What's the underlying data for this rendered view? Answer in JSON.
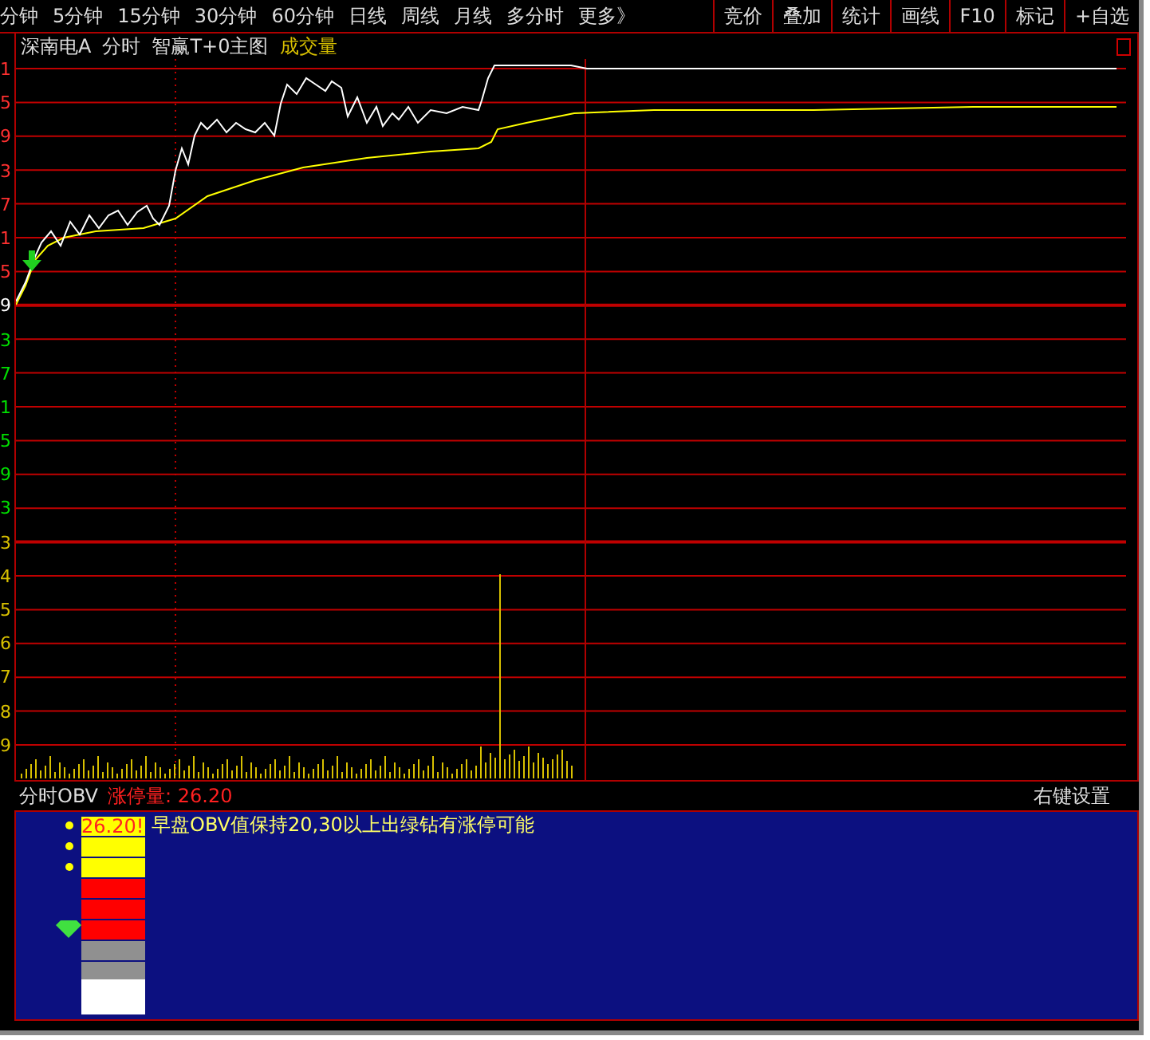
{
  "toolbar": {
    "periods": [
      {
        "label": "分钟",
        "selected": false
      },
      {
        "label": "5分钟",
        "selected": false
      },
      {
        "label": "15分钟",
        "selected": false
      },
      {
        "label": "30分钟",
        "selected": false
      },
      {
        "label": "60分钟",
        "selected": false
      },
      {
        "label": "日线",
        "selected": false
      },
      {
        "label": "周线",
        "selected": false
      },
      {
        "label": "月线",
        "selected": false
      },
      {
        "label": "多分时",
        "selected": false
      },
      {
        "label": "更多》",
        "selected": false
      }
    ],
    "buttons": [
      "竞价",
      "叠加",
      "统计",
      "画线",
      "F10",
      "标记",
      "+自选"
    ]
  },
  "chart": {
    "stock": "深南电A",
    "mode": "分时",
    "indicator": "智赢T+0主图",
    "volume_label": "成交量",
    "axis_labels": [
      {
        "text": "1",
        "color": "#ff3030"
      },
      {
        "text": "5",
        "color": "#ff3030"
      },
      {
        "text": "9",
        "color": "#ff3030"
      },
      {
        "text": "3",
        "color": "#ff3030"
      },
      {
        "text": "7",
        "color": "#ff3030"
      },
      {
        "text": "1",
        "color": "#ff3030"
      },
      {
        "text": "5",
        "color": "#ff3030"
      },
      {
        "text": "9",
        "color": "#ffffff"
      },
      {
        "text": "3",
        "color": "#00e000"
      },
      {
        "text": "7",
        "color": "#00e000"
      },
      {
        "text": "1",
        "color": "#00e000"
      },
      {
        "text": "5",
        "color": "#00e000"
      },
      {
        "text": "9",
        "color": "#00e000"
      },
      {
        "text": "3",
        "color": "#00e000"
      },
      {
        "text": "3",
        "color": "#d8c000"
      },
      {
        "text": "4",
        "color": "#d8c000"
      },
      {
        "text": "5",
        "color": "#d8c000"
      },
      {
        "text": "6",
        "color": "#d8c000"
      },
      {
        "text": "7",
        "color": "#d8c000"
      },
      {
        "text": "8",
        "color": "#d8c000"
      },
      {
        "text": "9",
        "color": "#d8c000"
      }
    ]
  },
  "obv": {
    "title": "分时OBV",
    "limit_label": "涨停量: 26.20",
    "settings": "右键设置",
    "value_tag": "26.20!",
    "message": "早盘OBV值保持20,30以上出绿钻有涨停可能",
    "blocks": [
      {
        "color": "#ffff00",
        "kind": "dot"
      },
      {
        "color": "#ffff00",
        "kind": "dot"
      },
      {
        "color": "#ffff00",
        "kind": "dot"
      },
      {
        "color": "#ff0000",
        "kind": "plain"
      },
      {
        "color": "#ff0000",
        "kind": "plain"
      },
      {
        "color": "#ff0000",
        "kind": "diamond"
      },
      {
        "color": "#909090",
        "kind": "plain"
      },
      {
        "color": "#909090",
        "kind": "plain"
      },
      {
        "color": "#ffffff",
        "kind": "plain"
      }
    ]
  }
}
